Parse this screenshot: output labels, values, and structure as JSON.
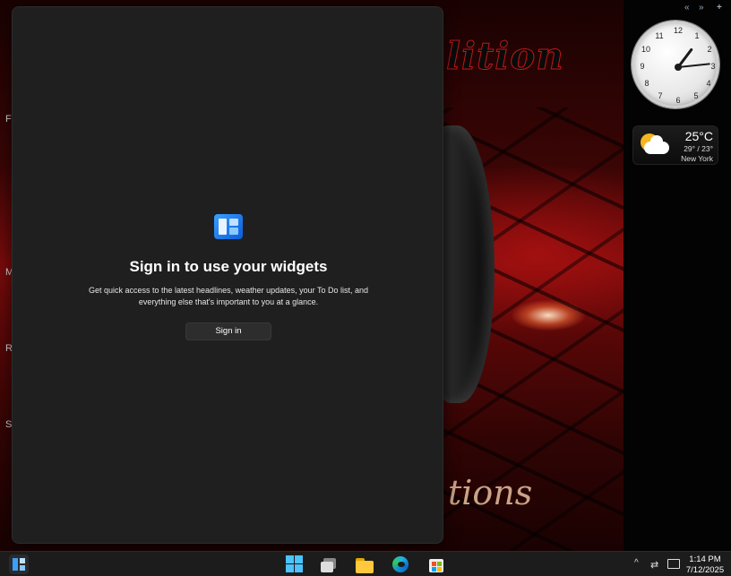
{
  "desktop": {
    "wallpaper_text_top": "lition",
    "wallpaper_text_bottom": "tions",
    "icon_labels": [
      "F",
      "M",
      "R",
      "S"
    ]
  },
  "widgets_panel": {
    "title": "Sign in to use your widgets",
    "description": "Get quick access to the latest headlines, weather updates, your To Do list, and everything else that's important to you at a glance.",
    "sign_in_label": "Sign in"
  },
  "gadget_controls": {
    "prev": "«",
    "next": "»",
    "add": "+"
  },
  "clock": {
    "numbers": [
      "12",
      "1",
      "2",
      "3",
      "4",
      "5",
      "6",
      "7",
      "8",
      "9",
      "10",
      "11"
    ],
    "time": "1:14"
  },
  "weather": {
    "temperature": "25°C",
    "range": "29° / 23°",
    "city": "New York",
    "icon": "partly-cloudy-icon"
  },
  "taskbar": {
    "icons": [
      "widgets-icon",
      "start-icon",
      "task-view-icon",
      "file-explorer-icon",
      "edge-icon",
      "store-icon"
    ],
    "tray": {
      "chevron": "^",
      "time": "1:14 PM",
      "date": "7/12/2025"
    }
  },
  "colors": {
    "accent": "#3aa0ff",
    "panel_bg": "#1f1f1f",
    "taskbar_bg": "#1c1c1c"
  }
}
